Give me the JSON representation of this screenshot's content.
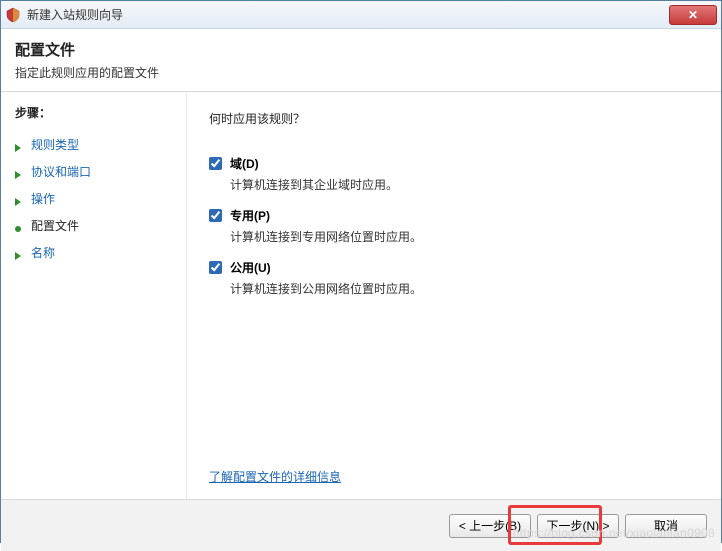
{
  "titlebar": {
    "title": "新建入站规则向导",
    "close": "✕"
  },
  "header": {
    "title": "配置文件",
    "subtitle": "指定此规则应用的配置文件"
  },
  "sidebar": {
    "steps_label": "步骤：",
    "items": [
      {
        "label": "规则类型",
        "current": false
      },
      {
        "label": "协议和端口",
        "current": false
      },
      {
        "label": "操作",
        "current": false
      },
      {
        "label": "配置文件",
        "current": true
      },
      {
        "label": "名称",
        "current": false
      }
    ]
  },
  "main": {
    "question": "何时应用该规则？",
    "options": [
      {
        "label": "域(D)",
        "checked": true,
        "desc": "计算机连接到其企业域时应用。"
      },
      {
        "label": "专用(P)",
        "checked": true,
        "desc": "计算机连接到专用网络位置时应用。"
      },
      {
        "label": "公用(U)",
        "checked": true,
        "desc": "计算机连接到公用网络位置时应用。"
      }
    ],
    "learn_more": "了解配置文件的详细信息"
  },
  "footer": {
    "back": "< 上一步(B)",
    "next": "下一步(N) >",
    "cancel": "取消"
  },
  "watermark": "https://blog.csdn.net/xiaolanlan0908"
}
